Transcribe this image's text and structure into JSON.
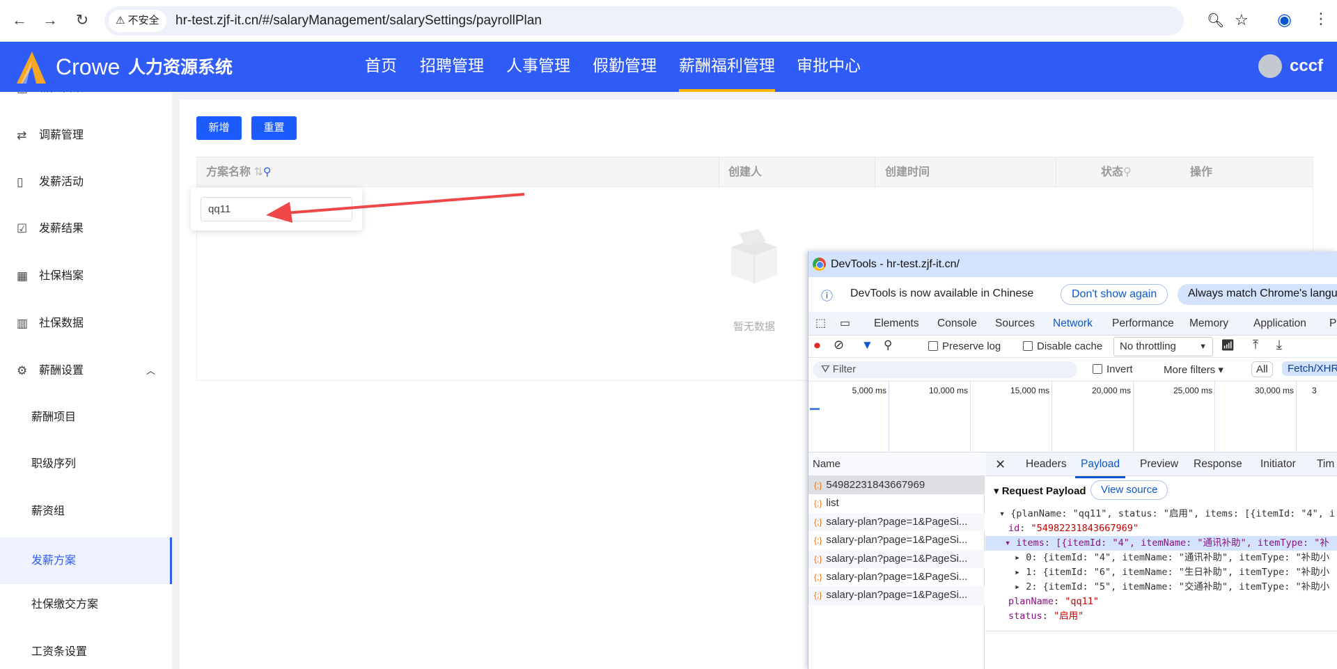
{
  "browser": {
    "insecure_label": "不安全",
    "url": "hr-test.zjf-it.cn/#/salaryManagement/salarySettings/payrollPlan"
  },
  "header": {
    "brand": "Crowe",
    "system_name": "人力资源系统",
    "nav": [
      "首页",
      "招聘管理",
      "人事管理",
      "假勤管理",
      "薪酬福利管理",
      "审批中心"
    ],
    "active_nav": "薪酬福利管理",
    "user": "cccf",
    "accent": "#2f5bf7"
  },
  "sidebar": {
    "items": [
      {
        "label": "薪资档案",
        "icon": "file-icon"
      },
      {
        "label": "调薪管理",
        "icon": "exchange-icon"
      },
      {
        "label": "发薪活动",
        "icon": "clipboard-icon"
      },
      {
        "label": "发薪结果",
        "icon": "clipboard-check-icon"
      },
      {
        "label": "社保档案",
        "icon": "grid-icon"
      },
      {
        "label": "社保数据",
        "icon": "bar-chart-icon"
      },
      {
        "label": "薪酬设置",
        "icon": "gear-icon",
        "expanded": true
      },
      {
        "label": "薪酬项目"
      },
      {
        "label": "职级序列"
      },
      {
        "label": "薪资组"
      },
      {
        "label": "发薪方案",
        "active": true
      },
      {
        "label": "社保缴交方案"
      },
      {
        "label": "工资条设置"
      }
    ]
  },
  "toolbar": {
    "add": "新增",
    "reset": "重置"
  },
  "table": {
    "columns": [
      "方案名称",
      "创建人",
      "创建时间",
      "状态",
      "操作"
    ],
    "empty_text": "暂无数据"
  },
  "filter_popup": {
    "value": "qq11"
  },
  "devtools": {
    "title": "DevTools - hr-test.zjf-it.cn/",
    "info": "DevTools is now available in Chinese",
    "dont_show": "Don't show again",
    "always_match": "Always match Chrome's langu",
    "tabs": [
      "Elements",
      "Console",
      "Sources",
      "Network",
      "Performance",
      "Memory",
      "Application",
      "Pr"
    ],
    "active_tab": "Network",
    "preserve_log": "Preserve log",
    "disable_cache": "Disable cache",
    "throttling": "No throttling",
    "filter_placeholder": "Filter",
    "invert": "Invert",
    "more_filters": "More filters",
    "type_all": "All",
    "type_fetch": "Fetch/XHR",
    "timeline_ticks": [
      "5,000 ms",
      "10,000 ms",
      "15,000 ms",
      "20,000 ms",
      "25,000 ms",
      "30,000 ms",
      "3"
    ],
    "name_header": "Name",
    "requests": [
      "54982231843667969",
      "list",
      "salary-plan?page=1&PageSi...",
      "salary-plan?page=1&PageSi...",
      "salary-plan?page=1&PageSi...",
      "salary-plan?page=1&PageSi...",
      "salary-plan?page=1&PageSi..."
    ],
    "detail_tabs": [
      "Headers",
      "Payload",
      "Preview",
      "Response",
      "Initiator",
      "Tim"
    ],
    "active_detail_tab": "Payload",
    "payload_title": "Request Payload",
    "view_source": "View source",
    "payload": {
      "summary": "{planName: \"qq11\", status: \"启用\", items: [{itemId: \"4\", i",
      "id_key": "id",
      "id_val": "\"54982231843667969\"",
      "items_line": "items: [{itemId: \"4\", itemName: \"通讯补助\", itemType: \"补",
      "items": [
        "0: {itemId: \"4\", itemName: \"通讯补助\", itemType: \"补助小",
        "1: {itemId: \"6\", itemName: \"生日补助\", itemType: \"补助小",
        "2: {itemId: \"5\", itemName: \"交通补助\", itemType: \"补助小"
      ],
      "planName_key": "planName",
      "planName_val": "\"qq11\"",
      "status_key": "status",
      "status_val": "\"启用\""
    }
  }
}
